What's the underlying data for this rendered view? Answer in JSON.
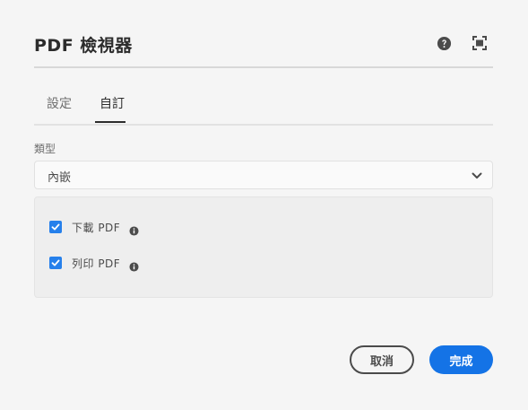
{
  "dialog": {
    "title": "PDF 檢視器"
  },
  "tabs": [
    {
      "label": "設定",
      "active": false
    },
    {
      "label": "自訂",
      "active": true
    }
  ],
  "type_field": {
    "label": "類型",
    "value": "內嵌"
  },
  "options": [
    {
      "label": "下載 PDF",
      "checked": true
    },
    {
      "label": "列印 PDF",
      "checked": true
    }
  ],
  "footer": {
    "cancel_label": "取消",
    "done_label": "完成"
  },
  "icons": {
    "help": "help-icon",
    "fullscreen": "fullscreen-icon",
    "chevron": "chevron-down-icon",
    "info": "info-icon",
    "check": "checkmark-icon"
  },
  "colors": {
    "accent": "#1473e6",
    "checkbox": "#2680eb",
    "text": "#2c2c2c",
    "background": "#f5f5f5"
  }
}
